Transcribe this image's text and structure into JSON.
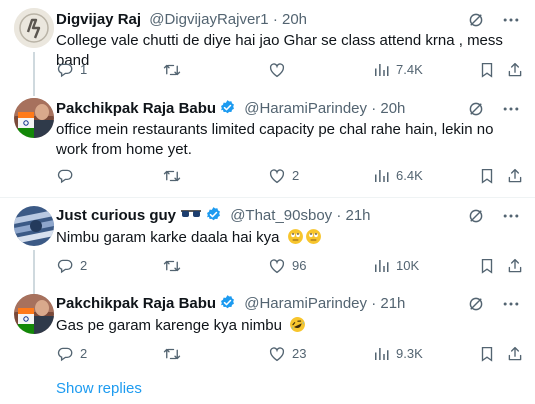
{
  "tweets": [
    {
      "name": "Digvijay Raj",
      "handle": "@DigvijayRajver1",
      "time": "20h",
      "text": "College vale  chutti de diye hai jao Ghar se class attend krna , mess band",
      "replies": "1",
      "retweets": "",
      "likes": "",
      "views": "7.4K",
      "verified": false
    },
    {
      "name": "Pakchikpak Raja Babu",
      "handle": "@HaramiParindey",
      "time": "20h",
      "text": "office mein restaurants limited capacity pe chal rahe hain, lekin no work from home yet.",
      "replies": "",
      "retweets": "",
      "likes": "2",
      "views": "6.4K",
      "verified": true
    },
    {
      "name": "Just curious guy",
      "handle": "@That_90sboy",
      "time": "21h",
      "text": "Nimbu garam karke daala hai kya",
      "replies": "2",
      "retweets": "",
      "likes": "96",
      "views": "10K",
      "verified": true
    },
    {
      "name": "Pakchikpak Raja Babu",
      "handle": "@HaramiParindey",
      "time": "21h",
      "text": "Gas pe garam karenge kya nimbu",
      "replies": "2",
      "retweets": "",
      "likes": "23",
      "views": "9.3K",
      "verified": true
    }
  ],
  "separator_dot": "·",
  "show_replies": "Show replies",
  "colors": {
    "accent": "#1d9bf0",
    "muted": "#536471",
    "text": "#0f1419",
    "line": "#cfd9de"
  },
  "icons": [
    "grok-icon",
    "more-icon",
    "reply-icon",
    "retweet-icon",
    "like-icon",
    "views-icon",
    "bookmark-icon",
    "share-icon",
    "verified-icon",
    "sunglasses-emoji",
    "rolling-eyes-emoji",
    "rofl-emoji"
  ]
}
